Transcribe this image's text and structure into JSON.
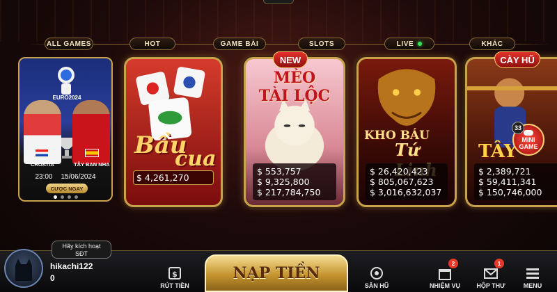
{
  "tabs": {
    "all_games": "ALL GAMES",
    "hot": "HOT",
    "game_bai": "GAME BÀI",
    "slots": "SLOTS",
    "live": "LIVE",
    "khac": "KHÁC"
  },
  "promo": {
    "logo_text": "EURO2024",
    "team_home": "CROATIA",
    "team_away": "TÂY BAN NHA",
    "time": "23:00",
    "date": "15/06/2024",
    "button": "CƯỢC NGAY"
  },
  "cards": {
    "bau_cua": {
      "title_line1": "Bầu",
      "title_line2": "cua",
      "prizes": [
        "$ 4,261,270"
      ]
    },
    "meo_tai_loc": {
      "badge": "NEW",
      "title_line1": "MÈO",
      "title_line2": "TÀI LỘC",
      "prizes": [
        "$ 553,757",
        "$ 9,325,800",
        "$ 217,784,750"
      ]
    },
    "kho_bau_tu_linh": {
      "title_line1": "KHO BÁU",
      "title_line2": "Tứ Linh",
      "prizes": [
        "$ 26,420,423",
        "$ 805,067,623",
        "$ 3,016,632,037"
      ]
    },
    "tay_du": {
      "badge": "CÀY HŨ",
      "title_partial": "TÂY",
      "prizes": [
        "$ 2,389,721",
        "$ 59,411,341",
        "$ 150,746,000"
      ]
    }
  },
  "mini_game": {
    "count": "33",
    "line1": "MINI",
    "line2": "GAME"
  },
  "user": {
    "kyc_prompt_line1": "Hãy kích hoạt",
    "kyc_prompt_line2": "SĐT",
    "username": "hikachi122",
    "balance": "0"
  },
  "bottom_nav": {
    "rut_tien": "RÚT TIỀN",
    "nap_tien": "NẠP TIỀN",
    "san_hu": "SĂN HŨ",
    "nhiem_vu": "NHIỆM VỤ",
    "nhiem_vu_badge": "2",
    "hop_thu": "HỘP THƯ",
    "hop_thu_badge": "1",
    "menu": "MENU"
  },
  "colors": {
    "gold": "#c9a24e",
    "badge_red": "#e3322c",
    "live_green": "#3be05a"
  }
}
